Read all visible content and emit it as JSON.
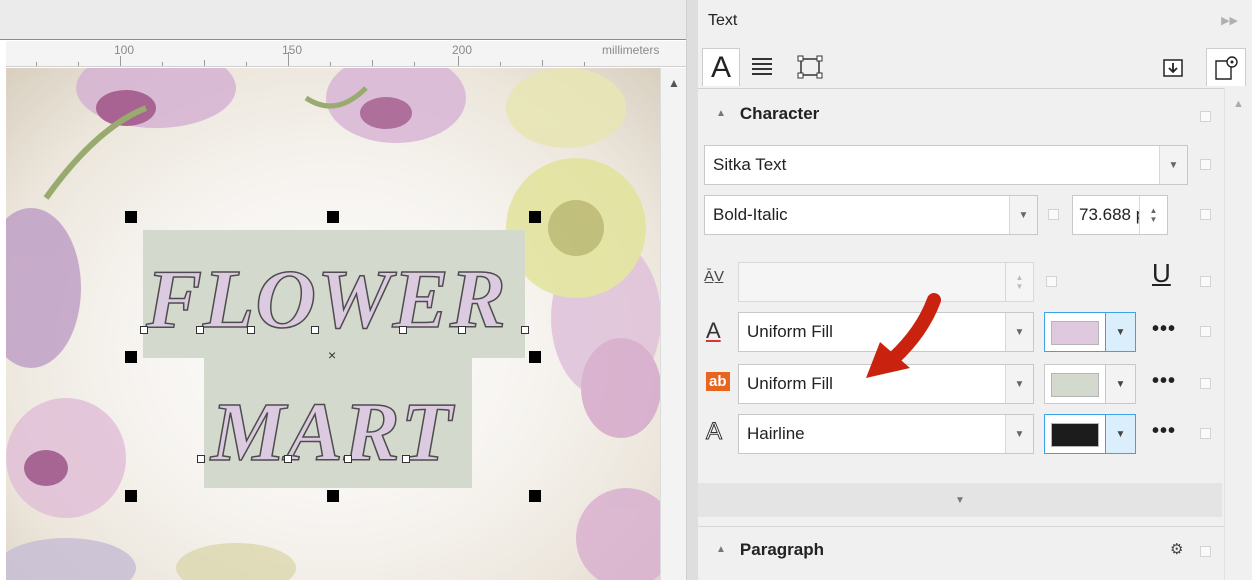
{
  "ruler": {
    "numbers": [
      "100",
      "150",
      "200"
    ],
    "unit": "millimeters"
  },
  "artwork": {
    "line1": "FLOWER",
    "line2": "MART",
    "fill_color": "#dccbe0",
    "frame_color": "#d3d9cd"
  },
  "docker": {
    "title": "Text",
    "tabs": [
      {
        "icon": "character-tab-icon",
        "active": true
      },
      {
        "icon": "paragraph-tab-icon",
        "active": false
      },
      {
        "icon": "frame-tab-icon",
        "active": false
      }
    ],
    "character": {
      "header": "Character",
      "font": "Sitka Text",
      "style": "Bold-Italic",
      "size": "73.688 p",
      "fill_type": "Uniform Fill",
      "fill_color": "#dfc9df",
      "background_type": "Uniform Fill",
      "background_color": "#d3d9cd",
      "outline_type": "Hairline",
      "outline_color": "#1c1c1c",
      "more_label": "•••"
    },
    "paragraph": {
      "header": "Paragraph"
    }
  }
}
